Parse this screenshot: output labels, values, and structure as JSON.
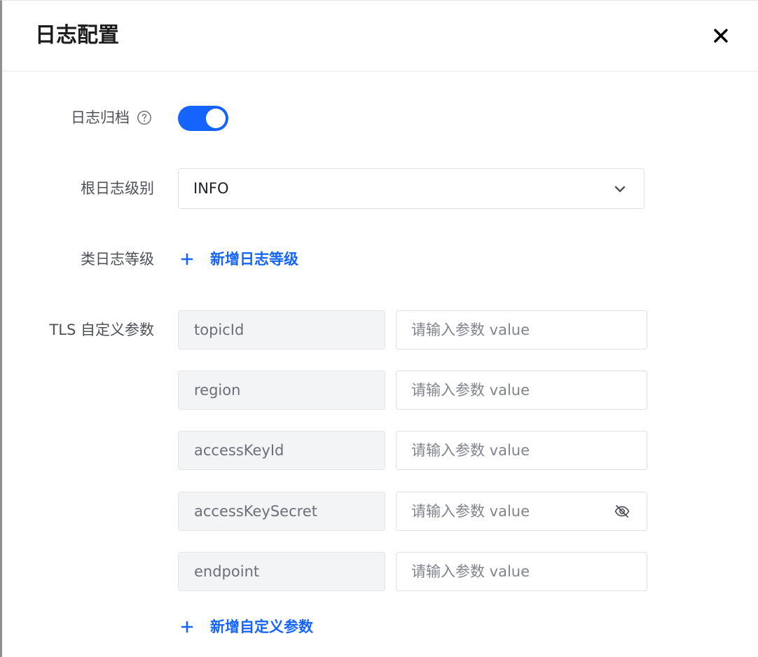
{
  "dialog": {
    "title": "日志配置"
  },
  "form": {
    "log_archive": {
      "label": "日志归档",
      "enabled": true
    },
    "root_log_level": {
      "label": "根日志级别",
      "selected": "INFO"
    },
    "class_log_level": {
      "label": "类日志等级",
      "add_label": "新增日志等级"
    },
    "tls_params": {
      "label": "TLS 自定义参数",
      "rows": [
        {
          "key": "topicId",
          "value": "",
          "placeholder": "请输入参数 value"
        },
        {
          "key": "region",
          "value": "",
          "placeholder": "请输入参数 value"
        },
        {
          "key": "accessKeyId",
          "value": "",
          "placeholder": "请输入参数 value"
        },
        {
          "key": "accessKeySecret",
          "value": "",
          "placeholder": "请输入参数 value"
        },
        {
          "key": "endpoint",
          "value": "",
          "placeholder": "请输入参数 value"
        }
      ],
      "add_label": "新增自定义参数"
    }
  },
  "colors": {
    "accent": "#1664ff",
    "label": "#4e5159",
    "disabled_bg": "#f3f4f6"
  },
  "icons": {
    "close": "close-icon",
    "help": "question-circle-icon",
    "dropdown": "chevron-down-icon",
    "add": "plus-icon",
    "password_toggle": "eye-off-icon"
  }
}
